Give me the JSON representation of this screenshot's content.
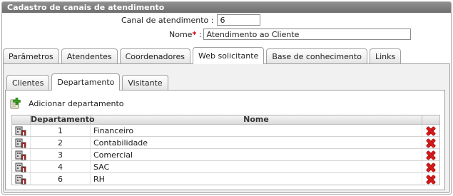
{
  "window": {
    "title": "Cadastro de canais de atendimento"
  },
  "form": {
    "canal_label": "Canal de atendimento :",
    "canal_value": "6",
    "nome_label": "Nome",
    "required_marker": "*",
    "nome_colon": ":",
    "nome_value": "Atendimento ao Cliente"
  },
  "main_tabs": [
    {
      "label": "Parâmetros"
    },
    {
      "label": "Atendentes"
    },
    {
      "label": "Coordenadores"
    },
    {
      "label": "Web solicitante",
      "active": true
    },
    {
      "label": "Base de conhecimento"
    },
    {
      "label": "Links"
    }
  ],
  "sub_tabs": [
    {
      "label": "Clientes"
    },
    {
      "label": "Departamento",
      "active": true
    },
    {
      "label": "Visitante"
    }
  ],
  "toolbar": {
    "add_label": "Adicionar departamento"
  },
  "grid": {
    "headers": {
      "icon": "",
      "departamento": "Departamento",
      "nome": "Nome",
      "delete": ""
    },
    "rows": [
      {
        "id": "1",
        "nome": "Financeiro"
      },
      {
        "id": "2",
        "nome": "Contabilidade"
      },
      {
        "id": "3",
        "nome": "Comercial"
      },
      {
        "id": "4",
        "nome": "SAC"
      },
      {
        "id": "6",
        "nome": "RH"
      }
    ]
  },
  "colors": {
    "title_bar": "#7f7f7f",
    "required": "#d40000",
    "delete_icon": "#d81a1a",
    "add_icon": "#3aa020"
  },
  "icons": {
    "row_icon": "department-building-icon",
    "delete": "delete-x-icon",
    "add": "add-department-icon"
  }
}
